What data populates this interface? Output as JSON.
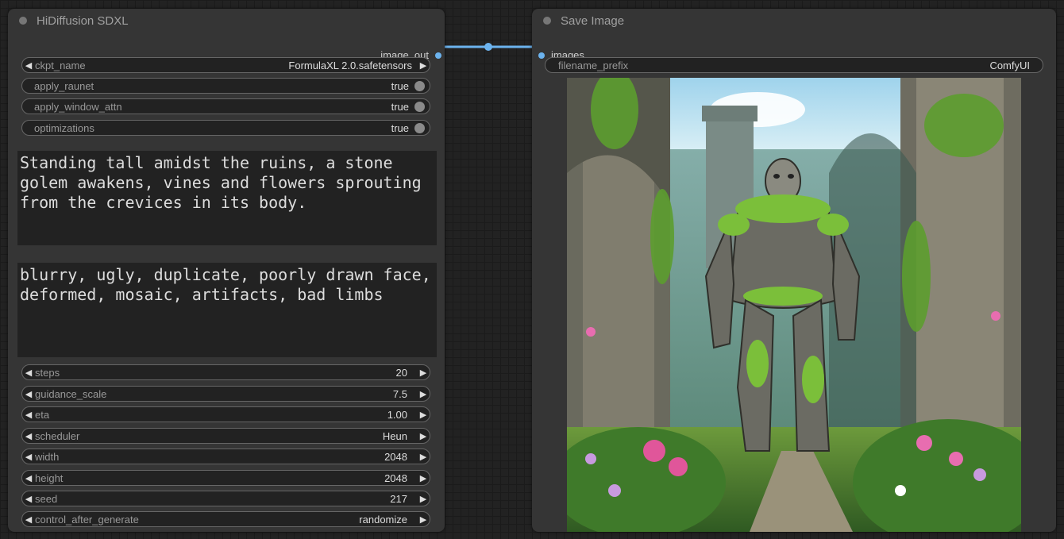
{
  "nodes": {
    "hidiffusion": {
      "title": "HiDiffusion SDXL",
      "output_label": "image_out",
      "ckpt": {
        "label": "ckpt_name",
        "value": "FormulaXL 2.0.safetensors"
      },
      "toggles": [
        {
          "label": "apply_raunet",
          "value": "true"
        },
        {
          "label": "apply_window_attn",
          "value": "true"
        },
        {
          "label": "optimizations",
          "value": "true"
        }
      ],
      "positive_prompt": "Standing tall amidst the ruins, a stone golem awakens, vines and flowers sprouting from the crevices in its body.",
      "negative_prompt": "blurry, ugly, duplicate, poorly drawn face, deformed, mosaic, artifacts, bad limbs",
      "params": [
        {
          "label": "steps",
          "value": "20"
        },
        {
          "label": "guidance_scale",
          "value": "7.5"
        },
        {
          "label": "eta",
          "value": "1.00"
        },
        {
          "label": "scheduler",
          "value": "Heun"
        },
        {
          "label": "width",
          "value": "2048"
        },
        {
          "label": "height",
          "value": "2048"
        },
        {
          "label": "seed",
          "value": "217"
        },
        {
          "label": "control_after_generate",
          "value": "randomize"
        }
      ]
    },
    "save_image": {
      "title": "Save Image",
      "input_label": "images",
      "filename_prefix": {
        "label": "filename_prefix",
        "value": "ComfyUI"
      }
    }
  },
  "colors": {
    "link": "#6cb3ee",
    "node_bg": "#353535",
    "canvas_bg": "#222222"
  },
  "icons": {
    "arrow_left": "◀",
    "arrow_right": "▶"
  }
}
